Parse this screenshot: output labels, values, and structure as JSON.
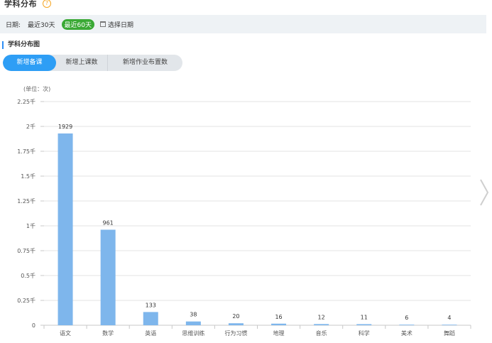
{
  "header": {
    "title": "学科分布",
    "help_glyph": "?"
  },
  "filter": {
    "label": "日期:",
    "options": [
      "最近30天",
      "最近60天"
    ],
    "active_option": "最近60天",
    "date_picker_label": "选择日期"
  },
  "section": {
    "title": "学科分布图"
  },
  "tabs": [
    {
      "label": "新增备课",
      "active": true
    },
    {
      "label": "新增上课数",
      "active": false
    },
    {
      "label": "新增作业布置数",
      "active": false
    }
  ],
  "chart_data": {
    "type": "bar",
    "unit_label": "(单位：次)",
    "categories": [
      "语文",
      "数学",
      "英语",
      "思维训练",
      "行为习惯",
      "地理",
      "音乐",
      "科学",
      "美术",
      "舞蹈"
    ],
    "values": [
      1929,
      961,
      133,
      38,
      20,
      16,
      12,
      11,
      6,
      4
    ],
    "y_ticks": [
      0,
      250,
      500,
      750,
      1000,
      1250,
      1500,
      1750,
      2000,
      2250
    ],
    "y_tick_labels": [
      "0",
      "0.25千",
      "0.5千",
      "0.75千",
      "1千",
      "1.25千",
      "1.5千",
      "1.75千",
      "2千",
      "2.25千"
    ],
    "ylim": [
      0,
      2250
    ],
    "grid": true,
    "legend": "none",
    "bar_color": "#7eb6ec"
  },
  "navigation": {
    "next_icon": "chevron-right-icon"
  }
}
